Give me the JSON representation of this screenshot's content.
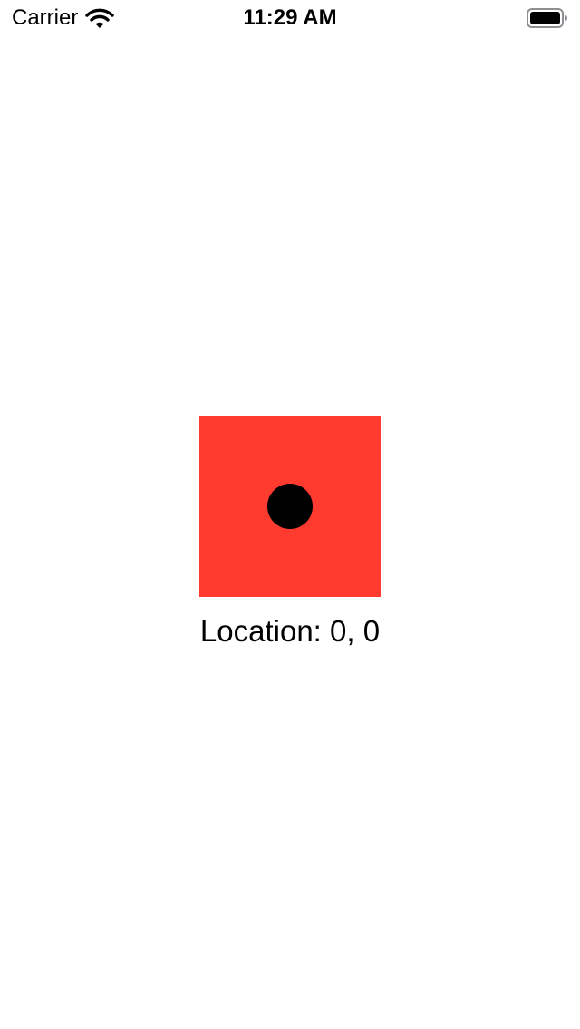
{
  "status_bar": {
    "carrier": "Carrier",
    "time": "11:29 AM",
    "wifi_icon": "wifi-icon",
    "battery_icon": "battery-full-icon"
  },
  "canvas": {
    "background_color": "#ff3b30",
    "dot_color": "#000000"
  },
  "location": {
    "text": "Location: 0, 0"
  }
}
